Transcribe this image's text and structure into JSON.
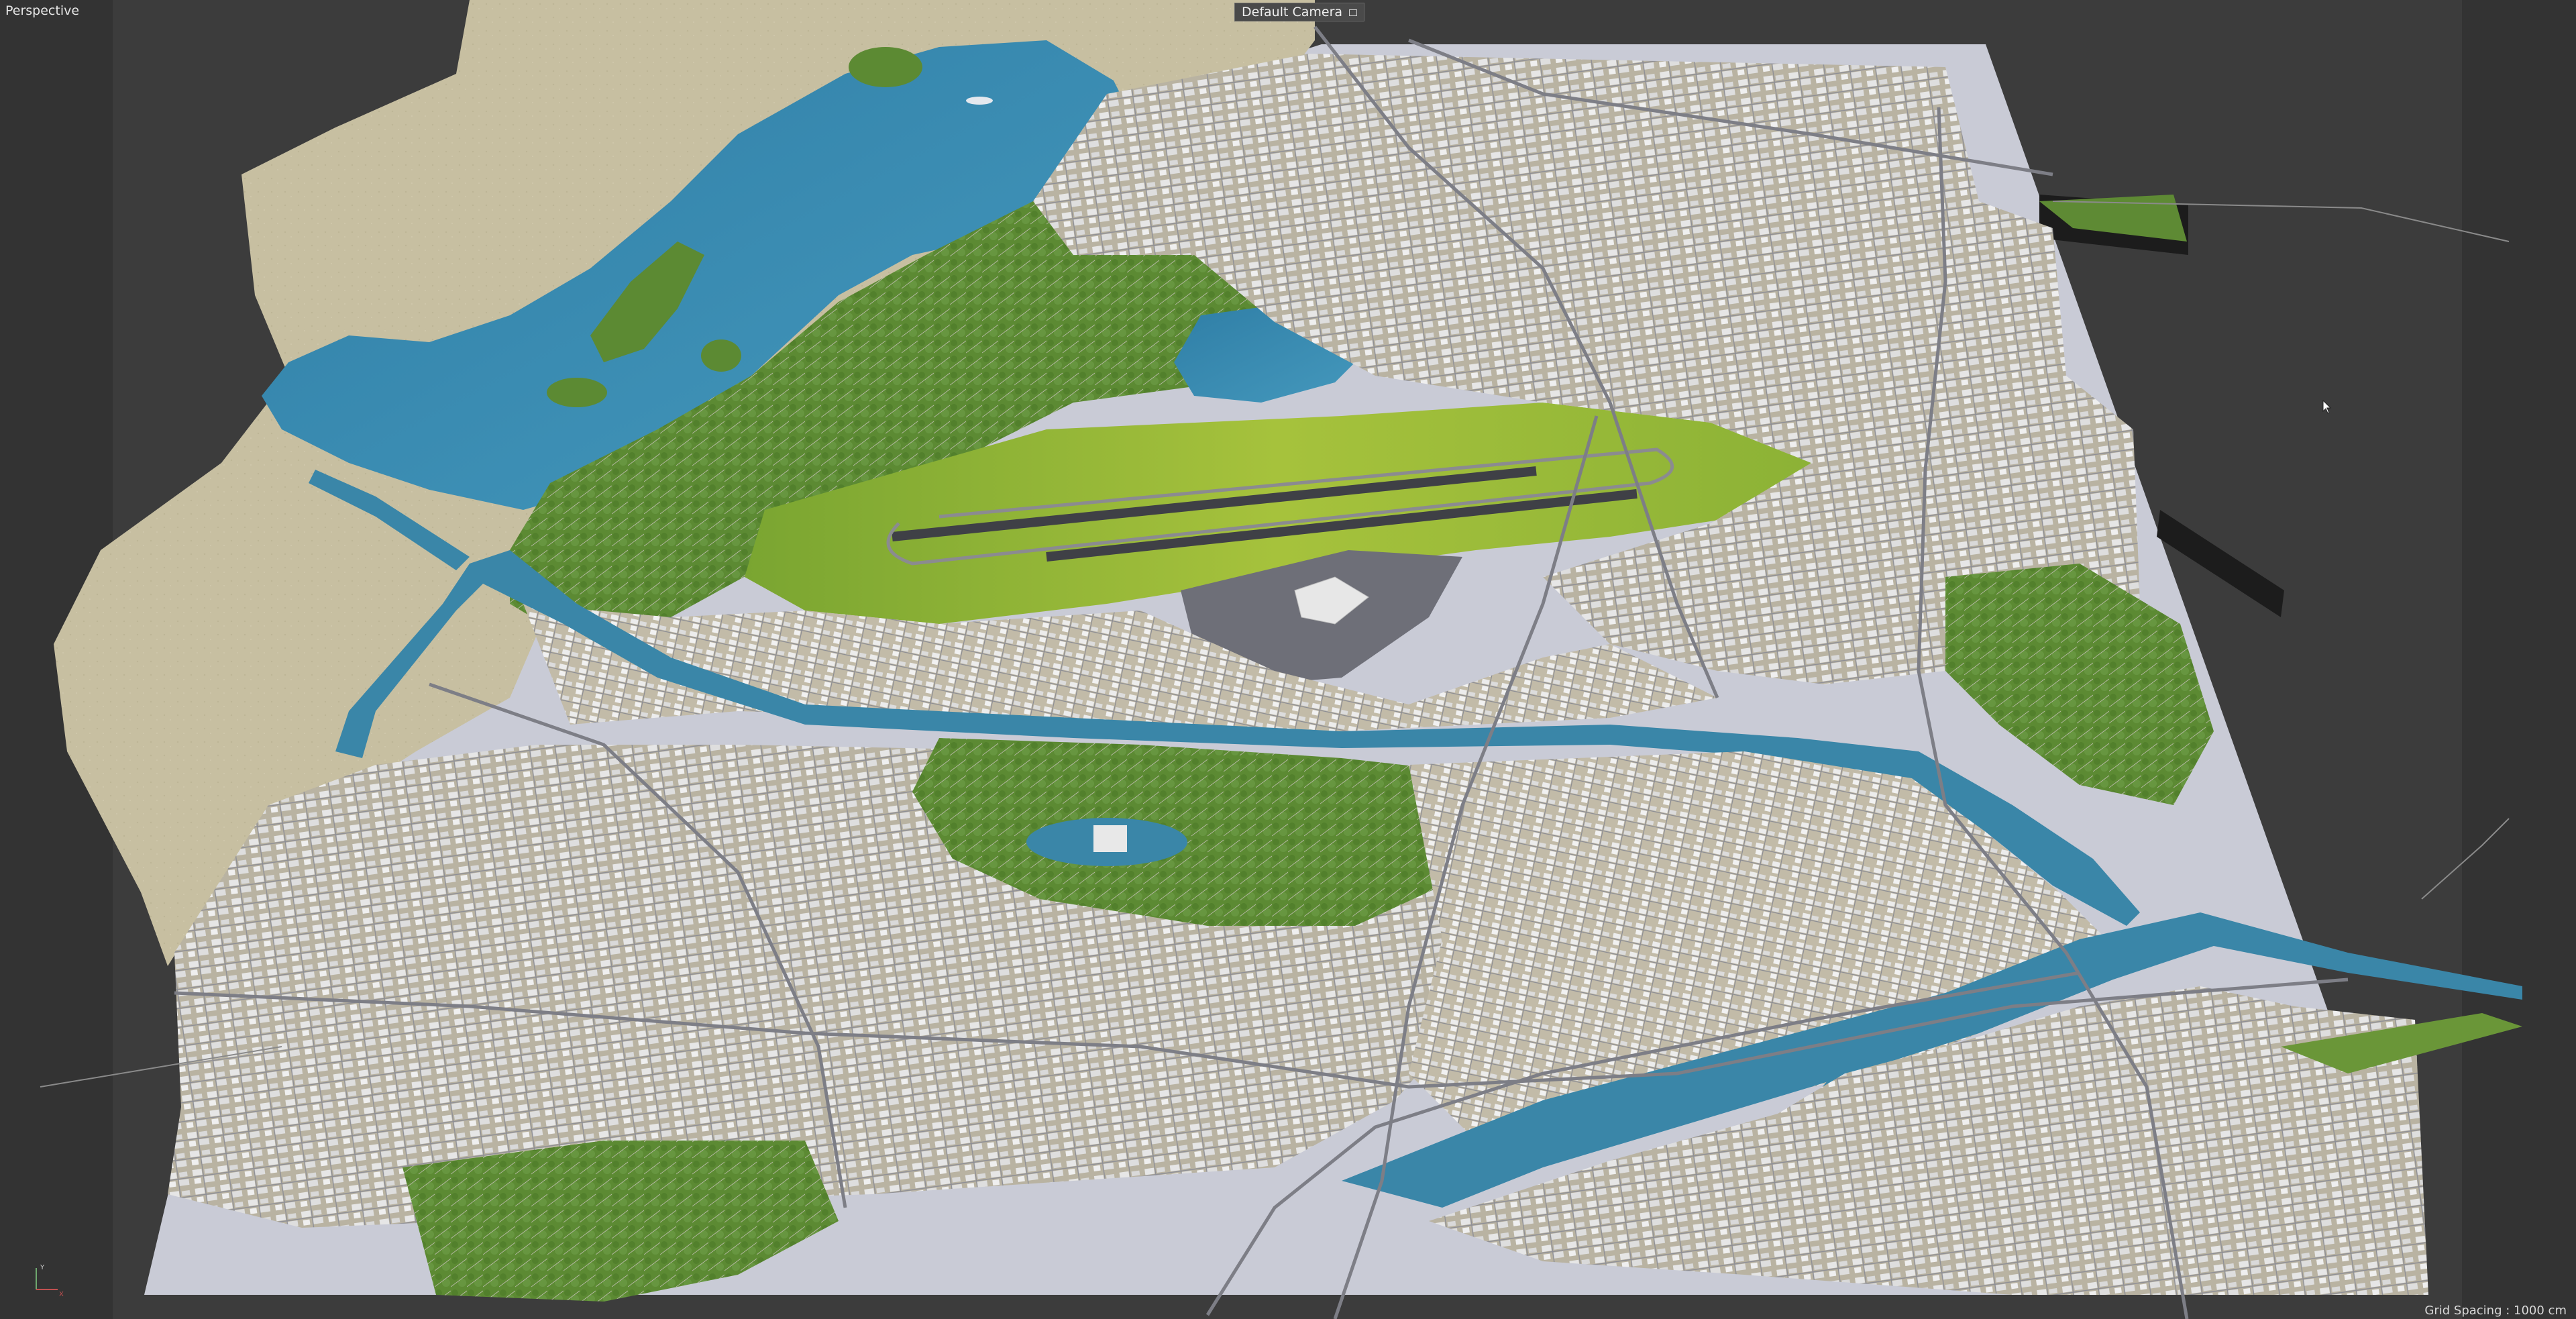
{
  "viewport": {
    "view_label": "Perspective",
    "camera_label": "Default Camera",
    "grid_spacing_label": "Grid Spacing : 1000 cm",
    "axis_labels": {
      "x": "X",
      "y": "Y"
    },
    "icons": [
      "camera-icon",
      "axis-gizmo-icon",
      "mouse-cursor-icon"
    ],
    "colors": {
      "background": "#3c3c3c",
      "ground_plane": "#c9cbd6",
      "sand": "#c8c0a2",
      "water": "#3a86a8",
      "forest": "#5e8a34",
      "grass": "#8fb33a",
      "runway": "#45464c",
      "urban": "#b8b1a0",
      "road": "#7f8088",
      "building": "#e8e8e8"
    }
  }
}
